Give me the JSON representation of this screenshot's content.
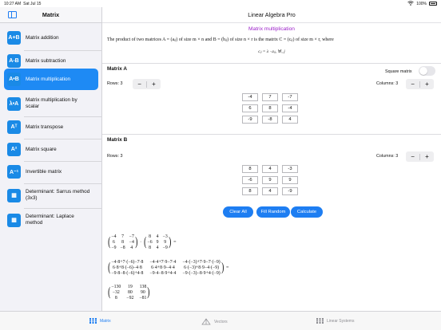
{
  "status_bar": {
    "time": "10:27 AM",
    "date": "Sat Jul 15",
    "battery": "100%"
  },
  "sidebar": {
    "title": "Matrix",
    "items": [
      {
        "icon": "A+B",
        "label": "Matrix addition"
      },
      {
        "icon": "A-B",
        "label": "Matrix subtraction"
      },
      {
        "icon": "A•B",
        "label": "Matrix multiplication"
      },
      {
        "icon": "λ•A",
        "label": "Matrix multiplication by scalar"
      },
      {
        "icon": "Aᵀ",
        "label": "Matrix transpose"
      },
      {
        "icon": "A²",
        "label": "Matrix square"
      },
      {
        "icon": "A⁻¹",
        "label": "Invertible matrix"
      },
      {
        "icon": "▦",
        "label": "Determinant: Sarrus method (3x3)"
      },
      {
        "icon": "▦",
        "label": "Determinant: Laplace method"
      }
    ],
    "active_index": 2
  },
  "main": {
    "app_title": "Linear Algebra Pro",
    "section_title": "Matrix multiplication",
    "description": "The product of two matrices A = (aᵢⱼ) of size m × n and B = (bᵢⱼ) of size n × r is the matrix C = (cᵢⱼ) of size m × r, where",
    "formula": "cᵢⱼ = λ · aᵢⱼ, ∀i, j",
    "matrix_a": {
      "label": "Matrix A",
      "rows_label": "Rows: 3",
      "columns_label": "Columns: 3",
      "square_label": "Square matrix",
      "values": [
        [
          "-4",
          "7",
          "-7"
        ],
        [
          "6",
          "8",
          "-4"
        ],
        [
          "-9",
          "-8",
          "4"
        ]
      ]
    },
    "matrix_b": {
      "label": "Matrix B",
      "rows_label": "Rows: 3",
      "columns_label": "Columns: 3",
      "values": [
        [
          "8",
          "4",
          "-3"
        ],
        [
          "-6",
          "9",
          "9"
        ],
        [
          "8",
          "4",
          "-9"
        ]
      ]
    },
    "stepper": {
      "minus": "−",
      "plus": "+"
    },
    "buttons": {
      "clear": "Clear All",
      "fill": "Fill Random",
      "calculate": "Calculate"
    },
    "result": {
      "a": [
        [
          "−4",
          "7",
          "−7"
        ],
        [
          "6",
          "8",
          "−4"
        ],
        [
          "−9",
          "−8",
          "4"
        ]
      ],
      "b": [
        [
          "8",
          "4",
          "−3"
        ],
        [
          "−6",
          "9",
          "9"
        ],
        [
          "8",
          "4",
          "−9"
        ]
      ],
      "expanded": [
        [
          "−4·8+7·(−6)−7·8",
          "−4·4+7·9−7·4",
          "−4·(−3)+7·9−7·(−9)"
        ],
        [
          "6·8+8·(−6)−4·8",
          "6·4+8·9−4·4",
          "6·(−3)+8·9−4·(−9)"
        ],
        [
          "−9·8−8·(−6)+4·8",
          "−9·4−8·9+4·4",
          "−9·(−3)−8·9+4·(−9)"
        ]
      ],
      "c": [
        [
          "−130",
          "19",
          "138"
        ],
        [
          "−32",
          "80",
          "90"
        ],
        [
          "8",
          "−92",
          "−81"
        ]
      ],
      "dot": "·",
      "eq": "="
    }
  },
  "tabs": [
    {
      "label": "Matrix",
      "icon": "matrix-tab-icon"
    },
    {
      "label": "Vectors",
      "icon": "vectors-tab-icon"
    },
    {
      "label": "Linear Systems",
      "icon": "linear-systems-tab-icon"
    }
  ],
  "colors": {
    "accent": "#1e7ef2",
    "section_title": "#9b1fc9",
    "sidebar_bg": "#f2f2f7"
  }
}
